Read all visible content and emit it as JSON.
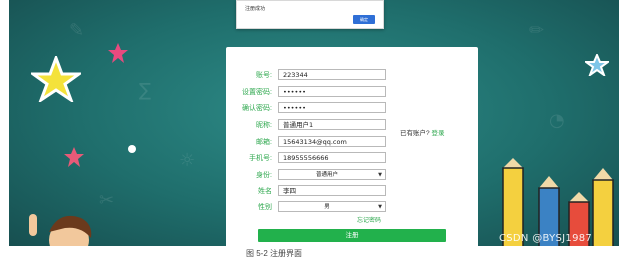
{
  "dialog": {
    "message": "注册成功",
    "ok_label": "确定"
  },
  "form": {
    "fields": [
      {
        "label": "账号:",
        "value": "223344"
      },
      {
        "label": "设置密码:",
        "value": "••••••"
      },
      {
        "label": "确认密码:",
        "value": "••••••"
      },
      {
        "label": "昵称:",
        "value": "普通用户1"
      },
      {
        "label": "邮箱:",
        "value": "15643134@qq.com"
      },
      {
        "label": "手机号:",
        "value": "18955556666"
      },
      {
        "label": "身份:",
        "value": "普通用户",
        "type": "select"
      },
      {
        "label": "姓名",
        "value": "李四"
      },
      {
        "label": "性别",
        "value": "男",
        "type": "select"
      }
    ],
    "forgot_label": "忘记密码",
    "submit_label": "注册",
    "has_account_text": "已有账户?",
    "login_link": "登录"
  },
  "caption": "图 5-2 注册界面",
  "watermark": "CSDN @BYSJ1987",
  "colors": {
    "accent_green": "#2fa84f",
    "button_green": "#22b14c",
    "board_teal": "#1f6e6c",
    "dialog_button": "#2f6fd6"
  }
}
